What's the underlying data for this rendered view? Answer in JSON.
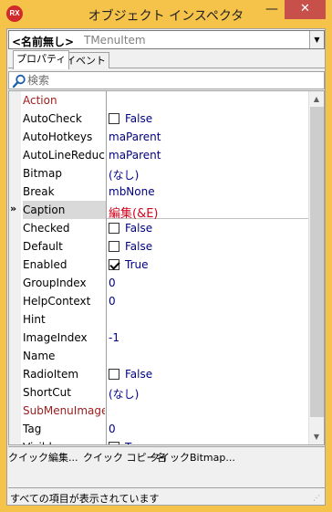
{
  "window": {
    "app_icon_text": "RX",
    "title": "オブジェクト インスペクタ",
    "minimize_glyph": "—",
    "close_glyph": "✕"
  },
  "object_selector": {
    "name": "<名前無し>",
    "type": "TMenuItem"
  },
  "tabs": [
    {
      "label": "プロパティ",
      "active": true
    },
    {
      "label": "イベント",
      "active": false
    }
  ],
  "search": {
    "placeholder": "検索"
  },
  "properties": [
    {
      "name": "Action",
      "value": "",
      "kind": "event"
    },
    {
      "name": "AutoCheck",
      "value": "False",
      "checkbox": "off"
    },
    {
      "name": "AutoHotkeys",
      "value": "maParent"
    },
    {
      "name": "AutoLineReduction",
      "value": "maParent"
    },
    {
      "name": "Bitmap",
      "value": "(なし)"
    },
    {
      "name": "Break",
      "value": "mbNone"
    },
    {
      "name": "Caption",
      "value": "編集(&E)",
      "selected": true,
      "marker": "»"
    },
    {
      "name": "Checked",
      "value": "False",
      "checkbox": "off"
    },
    {
      "name": "Default",
      "value": "False",
      "checkbox": "off"
    },
    {
      "name": "Enabled",
      "value": "True",
      "checkbox": "on"
    },
    {
      "name": "GroupIndex",
      "value": "0"
    },
    {
      "name": "HelpContext",
      "value": "0"
    },
    {
      "name": "Hint",
      "value": ""
    },
    {
      "name": "ImageIndex",
      "value": "-1"
    },
    {
      "name": "Name",
      "value": ""
    },
    {
      "name": "RadioItem",
      "value": "False",
      "checkbox": "off"
    },
    {
      "name": "ShortCut",
      "value": "(なし)"
    },
    {
      "name": "SubMenuImages",
      "value": "",
      "kind": "event"
    },
    {
      "name": "Tag",
      "value": "0"
    },
    {
      "name": "Visible",
      "value": "True",
      "checkbox": "on"
    }
  ],
  "hints": {
    "quick_edit": "クイック編集...",
    "quick_copy": "クイック コピー名",
    "quick_bitmap": "クイックBitmap..."
  },
  "status": {
    "text": "すべての項目が表示されています"
  },
  "colors": {
    "titlebar": "#f5c24a",
    "close_button": "#c7504b",
    "value_text": "#000080",
    "event_text": "#9b1b1b",
    "caption_value": "#d0021b"
  }
}
